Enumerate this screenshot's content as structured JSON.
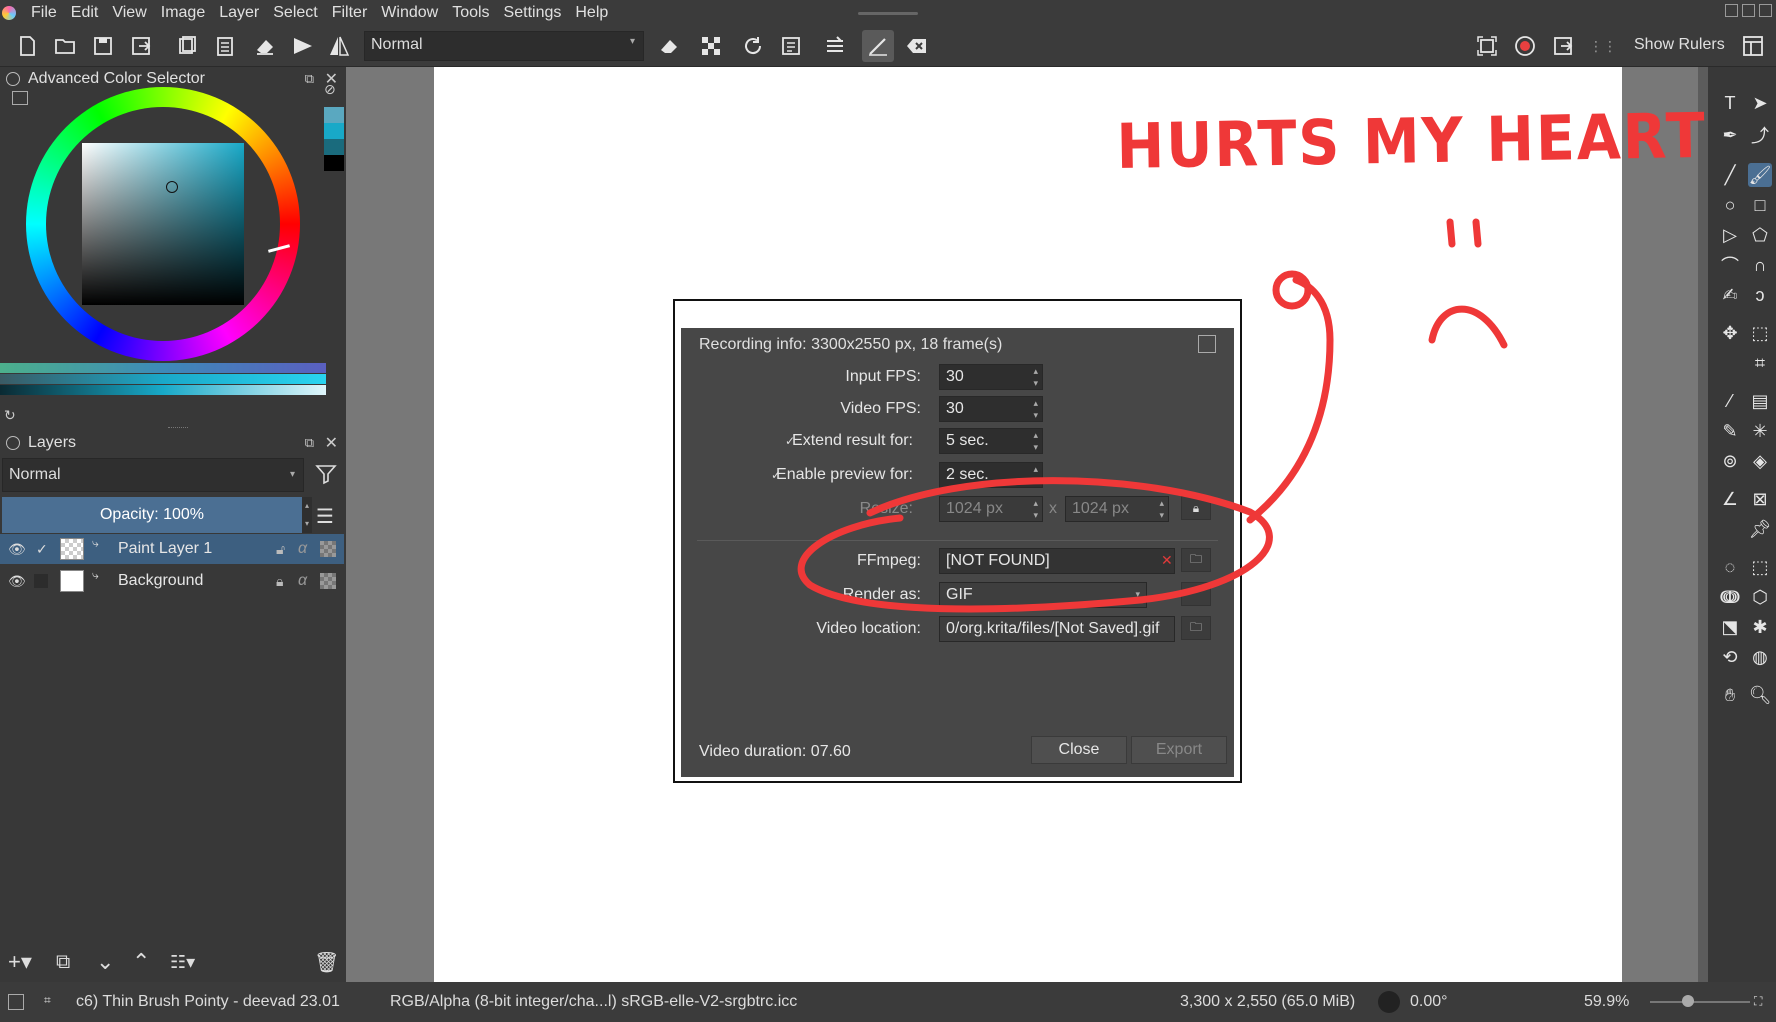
{
  "menubar": {
    "items": [
      "File",
      "Edit",
      "View",
      "Image",
      "Layer",
      "Select",
      "Filter",
      "Window",
      "Tools",
      "Settings",
      "Help"
    ]
  },
  "toolbar": {
    "blend_mode": "Normal",
    "show_rulers_label": "Show Rulers"
  },
  "color_selector": {
    "title": "Advanced Color Selector",
    "current_color": "#18a9c8"
  },
  "layers": {
    "title": "Layers",
    "blend_mode": "Normal",
    "opacity_label": "Opacity:  100%",
    "items": [
      {
        "name": "Paint Layer 1",
        "active": true
      },
      {
        "name": "Background",
        "active": false
      }
    ]
  },
  "dialog": {
    "title": "Recording info: 3300x2550 px, 18 frame(s)",
    "input_fps_label": "Input FPS:",
    "input_fps": "30",
    "video_fps_label": "Video FPS:",
    "video_fps": "30",
    "extend_label": "Extend result for:",
    "extend_value": "5 sec.",
    "preview_label": "Enable preview for:",
    "preview_value": "2 sec.",
    "resize_label": "Resize:",
    "resize_w": "1024 px",
    "resize_x": "x",
    "resize_h": "1024 px",
    "ffmpeg_label": "FFmpeg:",
    "ffmpeg_value": "[NOT FOUND]",
    "render_label": "Render as:",
    "render_value": "GIF",
    "location_label": "Video location:",
    "location_value": "0/org.krita/files/[Not Saved].gif",
    "duration": "Video duration: 07.60",
    "close_btn": "Close",
    "export_btn": "Export"
  },
  "annotation": {
    "text": "HURTS MY HEART",
    "color": "#ef3838"
  },
  "statusbar": {
    "brush": "c6) Thin Brush Pointy - deevad 23.01",
    "color_space": "RGB/Alpha (8-bit integer/cha...l)  sRGB-elle-V2-srgbtrc.icc",
    "dimensions": "3,300 x 2,550 (65.0 MiB)",
    "rotation": "0.00°",
    "zoom": "59.9%"
  }
}
